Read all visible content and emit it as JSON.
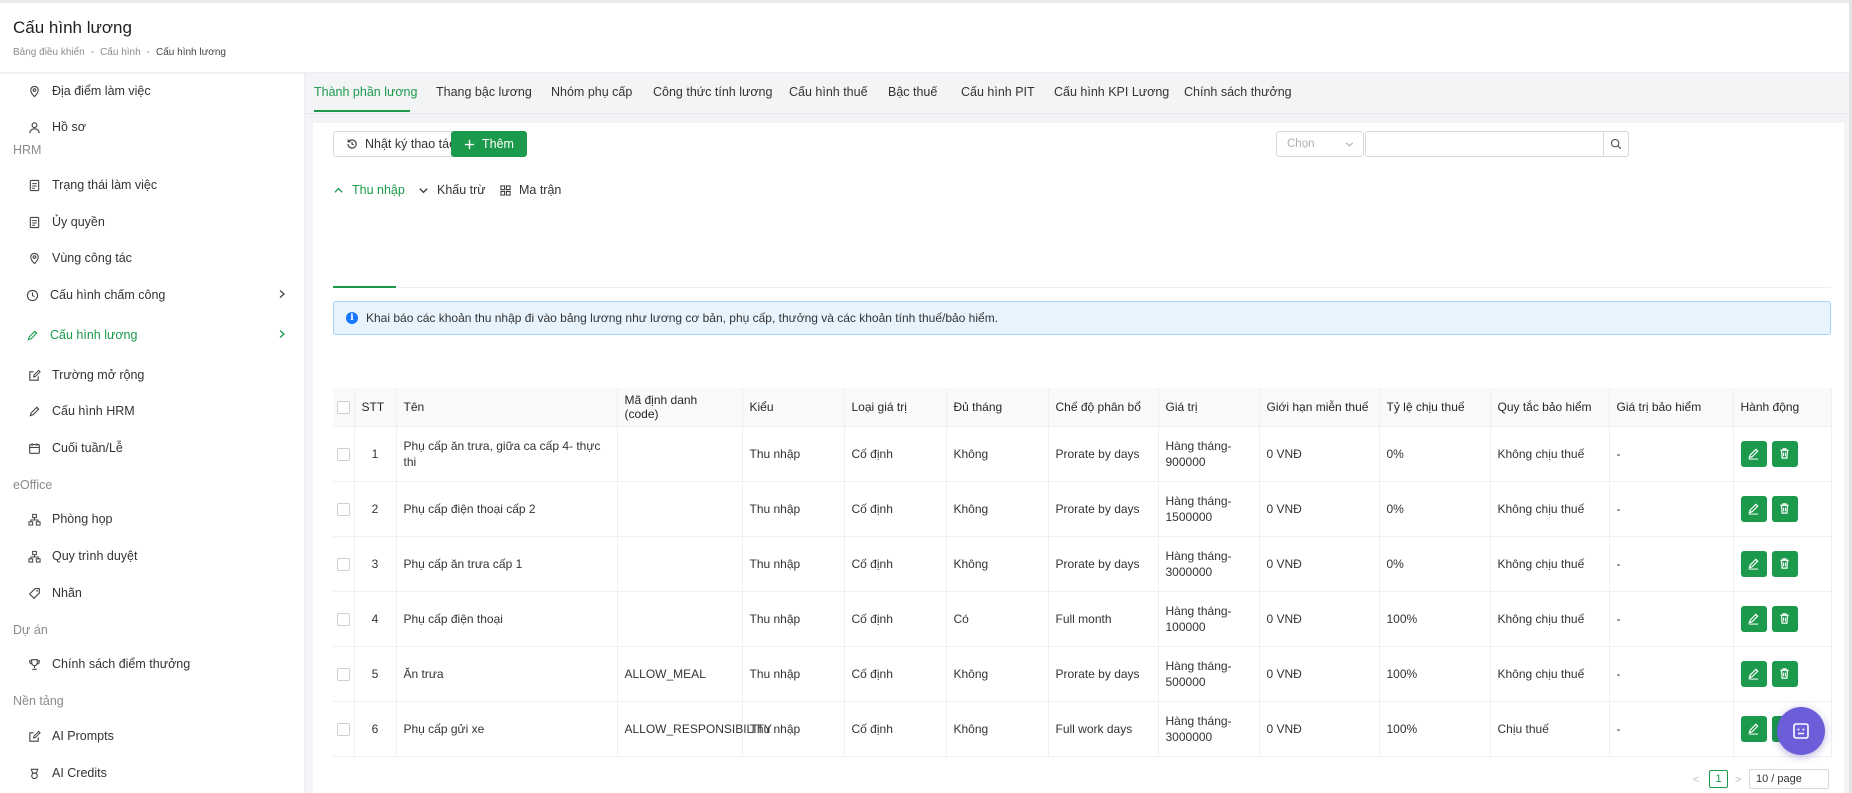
{
  "header": {
    "title": "Cấu hình lương",
    "breadcrumb": [
      "Bảng điều khiển",
      "Cấu hình",
      "Cấu hình lương"
    ],
    "separator": "-"
  },
  "sidebar": {
    "items": [
      {
        "label": "Địa điểm làm việc",
        "icon": "map-pin-icon"
      },
      {
        "label": "Hồ sơ",
        "icon": "user-icon"
      },
      {
        "label": "Trạng thái làm việc",
        "icon": "document-icon"
      },
      {
        "label": "Ủy quyền",
        "icon": "document-icon"
      },
      {
        "label": "Vùng công tác",
        "icon": "map-pin-icon"
      },
      {
        "label": "Cấu hình chấm công",
        "icon": "clock-icon"
      },
      {
        "label": "Cấu hình lương",
        "icon": "pencil-icon"
      },
      {
        "label": "Trường mở rộng",
        "icon": "edit-box-icon"
      },
      {
        "label": "Cấu hình HRM",
        "icon": "pencil-icon"
      },
      {
        "label": "Cuối tuần/Lễ",
        "icon": "calendar-icon"
      },
      {
        "label": "Phòng họp",
        "icon": "network-icon"
      },
      {
        "label": "Quy trình duyệt",
        "icon": "network-icon"
      },
      {
        "label": "Nhãn",
        "icon": "tag-icon"
      },
      {
        "label": "Chính sách điểm thưởng",
        "icon": "trophy-icon"
      },
      {
        "label": "AI Prompts",
        "icon": "edit-box-icon"
      },
      {
        "label": "AI Credits",
        "icon": "coin-icon"
      }
    ],
    "groups": [
      "HRM",
      "eOffice",
      "Dự án",
      "Nền tảng"
    ]
  },
  "tabs": [
    "Thành phần lương",
    "Thang bậc lương",
    "Nhóm phụ cấp",
    "Công thức tính lương",
    "Cấu hình thuế",
    "Bậc thuế",
    "Cấu hình PIT",
    "Cấu hình KPI Lương",
    "Chính sách thưởng"
  ],
  "toolbar": {
    "log_label": "Nhật ký thao tác",
    "add_label": "Thêm",
    "select_placeholder": "Chọn",
    "search_value": ""
  },
  "subtabs": [
    "Thu nhập",
    "Khấu trừ",
    "Ma trận"
  ],
  "alert": "Khai báo các khoản thu nhập đi vào bảng lương như lương cơ bản, phụ cấp, thưởng và các khoản tính thuế/bảo hiểm.",
  "table": {
    "headers": [
      "STT",
      "Tên",
      "Mã định danh (code)",
      "Kiểu",
      "Loại giá trị",
      "Đủ tháng",
      "Chế độ phân bổ",
      "Giá trị",
      "Giới hạn miễn thuế",
      "Tỷ lệ chịu thuế",
      "Quy tắc bảo hiểm",
      "Giá trị bảo hiểm",
      "Hành động"
    ],
    "rows": [
      [
        "1",
        "Phụ cấp ăn trưa, giữa ca cấp 4- thực thi",
        "",
        "Thu nhập",
        "Cố định",
        "Không",
        "Prorate by days",
        "Hàng tháng-900000",
        "0 VNĐ",
        "0%",
        "Không chịu thuế",
        "-"
      ],
      [
        "2",
        "Phụ cấp điện thoại cấp 2",
        "",
        "Thu nhập",
        "Cố định",
        "Không",
        "Prorate by days",
        "Hàng tháng-1500000",
        "0 VNĐ",
        "0%",
        "Không chịu thuế",
        "-"
      ],
      [
        "3",
        "Phụ cấp ăn trưa cấp 1",
        "",
        "Thu nhập",
        "Cố định",
        "Không",
        "Prorate by days",
        "Hàng tháng-3000000",
        "0 VNĐ",
        "0%",
        "Không chịu thuế",
        "-"
      ],
      [
        "4",
        "Phụ cấp điện thoại",
        "",
        "Thu nhập",
        "Cố định",
        "Có",
        "Full month",
        "Hàng tháng-100000",
        "0 VNĐ",
        "100%",
        "Không chịu thuế",
        "-"
      ],
      [
        "5",
        "Ăn trưa",
        "ALLOW_MEAL",
        "Thu nhập",
        "Cố định",
        "Không",
        "Prorate by days",
        "Hàng tháng-500000",
        "0 VNĐ",
        "100%",
        "Không chịu thuế",
        "-"
      ],
      [
        "6",
        "Phụ cấp gửi xe",
        "ALLOW_RESPONSIBILITY",
        "Thu nhập",
        "Cố định",
        "Không",
        "Full work days",
        "Hàng tháng-3000000",
        "0 VNĐ",
        "100%",
        "Chịu thuế",
        "-"
      ]
    ]
  },
  "pagination": {
    "prev": "<",
    "current": "1",
    "next": ">",
    "page_size": "10 / page"
  },
  "colors": {
    "accent": "#1a9a4a",
    "info": "#1677ff",
    "fab": "#6b5ed8"
  }
}
